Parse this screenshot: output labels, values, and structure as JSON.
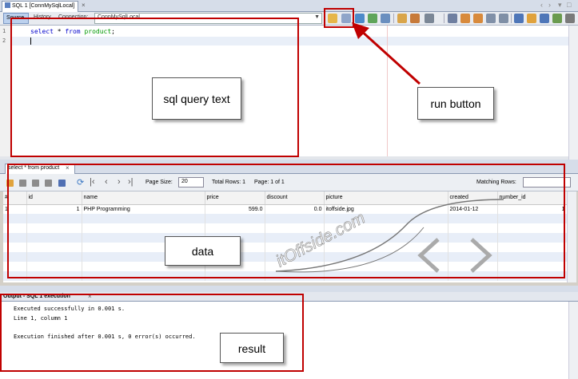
{
  "editor_tab": {
    "title": "SQL 1 [ConnMySqlLocal]",
    "close": "×"
  },
  "nav": {
    "left": "‹",
    "right": "›",
    "menu": "▾",
    "restore": "□"
  },
  "toolbar": {
    "source_label": "Source",
    "history_label": "History",
    "connection_label": "Connection:",
    "connection_value": "ConnMySqlLocal"
  },
  "editor": {
    "line_numbers": [
      "1",
      "2"
    ],
    "code": {
      "kw1": "select",
      "star": " * ",
      "kw2": "from",
      "space": " ",
      "table": "product",
      "semi": ";"
    }
  },
  "result_tab": {
    "title": "select * from product",
    "close": "×"
  },
  "result_toolbar": {
    "page_size_label": "Page Size:",
    "page_size_value": "20",
    "total_rows": "Total Rows: 1",
    "page_info": "Page: 1 of 1",
    "matching_label": "Matching Rows:"
  },
  "grid": {
    "columns": [
      "#",
      "id",
      "name",
      "price",
      "discount",
      "picture",
      "created",
      "number_id"
    ],
    "rows": [
      [
        "1",
        "1",
        "PHP Programming",
        "599.0",
        "0.0",
        "itoffside.jpg",
        "2014-01-12",
        "1"
      ]
    ]
  },
  "output": {
    "tab_title": "Output - SQL 1 execution",
    "close": "×",
    "lines": [
      "Executed successfully in 0.001 s.",
      "Line 1, column 1",
      "",
      "Execution finished after 0.001 s, 0 error(s) occurred."
    ]
  },
  "watermark": {
    "text": "itOffside.com"
  },
  "annotations": {
    "sql_query_text": "sql query text",
    "run_button": "run button",
    "data": "data",
    "result": "result"
  },
  "colors": {
    "annotation_red": "#c00000",
    "keyword_blue": "#0000cc",
    "table_green": "#009900",
    "selection_blue": "#bcd1ee"
  }
}
